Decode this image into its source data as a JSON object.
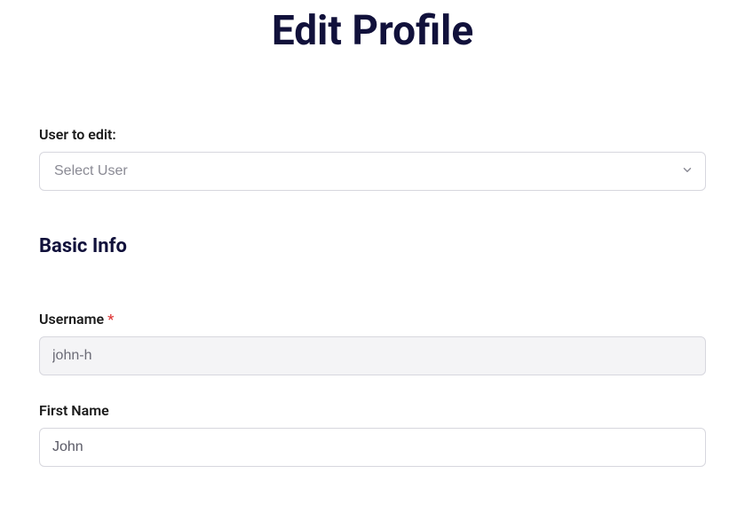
{
  "page": {
    "title": "Edit Profile"
  },
  "user_select": {
    "label": "User to edit:",
    "selected": "Select User"
  },
  "section": {
    "basic_info_title": "Basic Info"
  },
  "fields": {
    "username": {
      "label": "Username",
      "required_marker": "*",
      "value": "john-h"
    },
    "first_name": {
      "label": "First Name",
      "value": "John"
    }
  }
}
